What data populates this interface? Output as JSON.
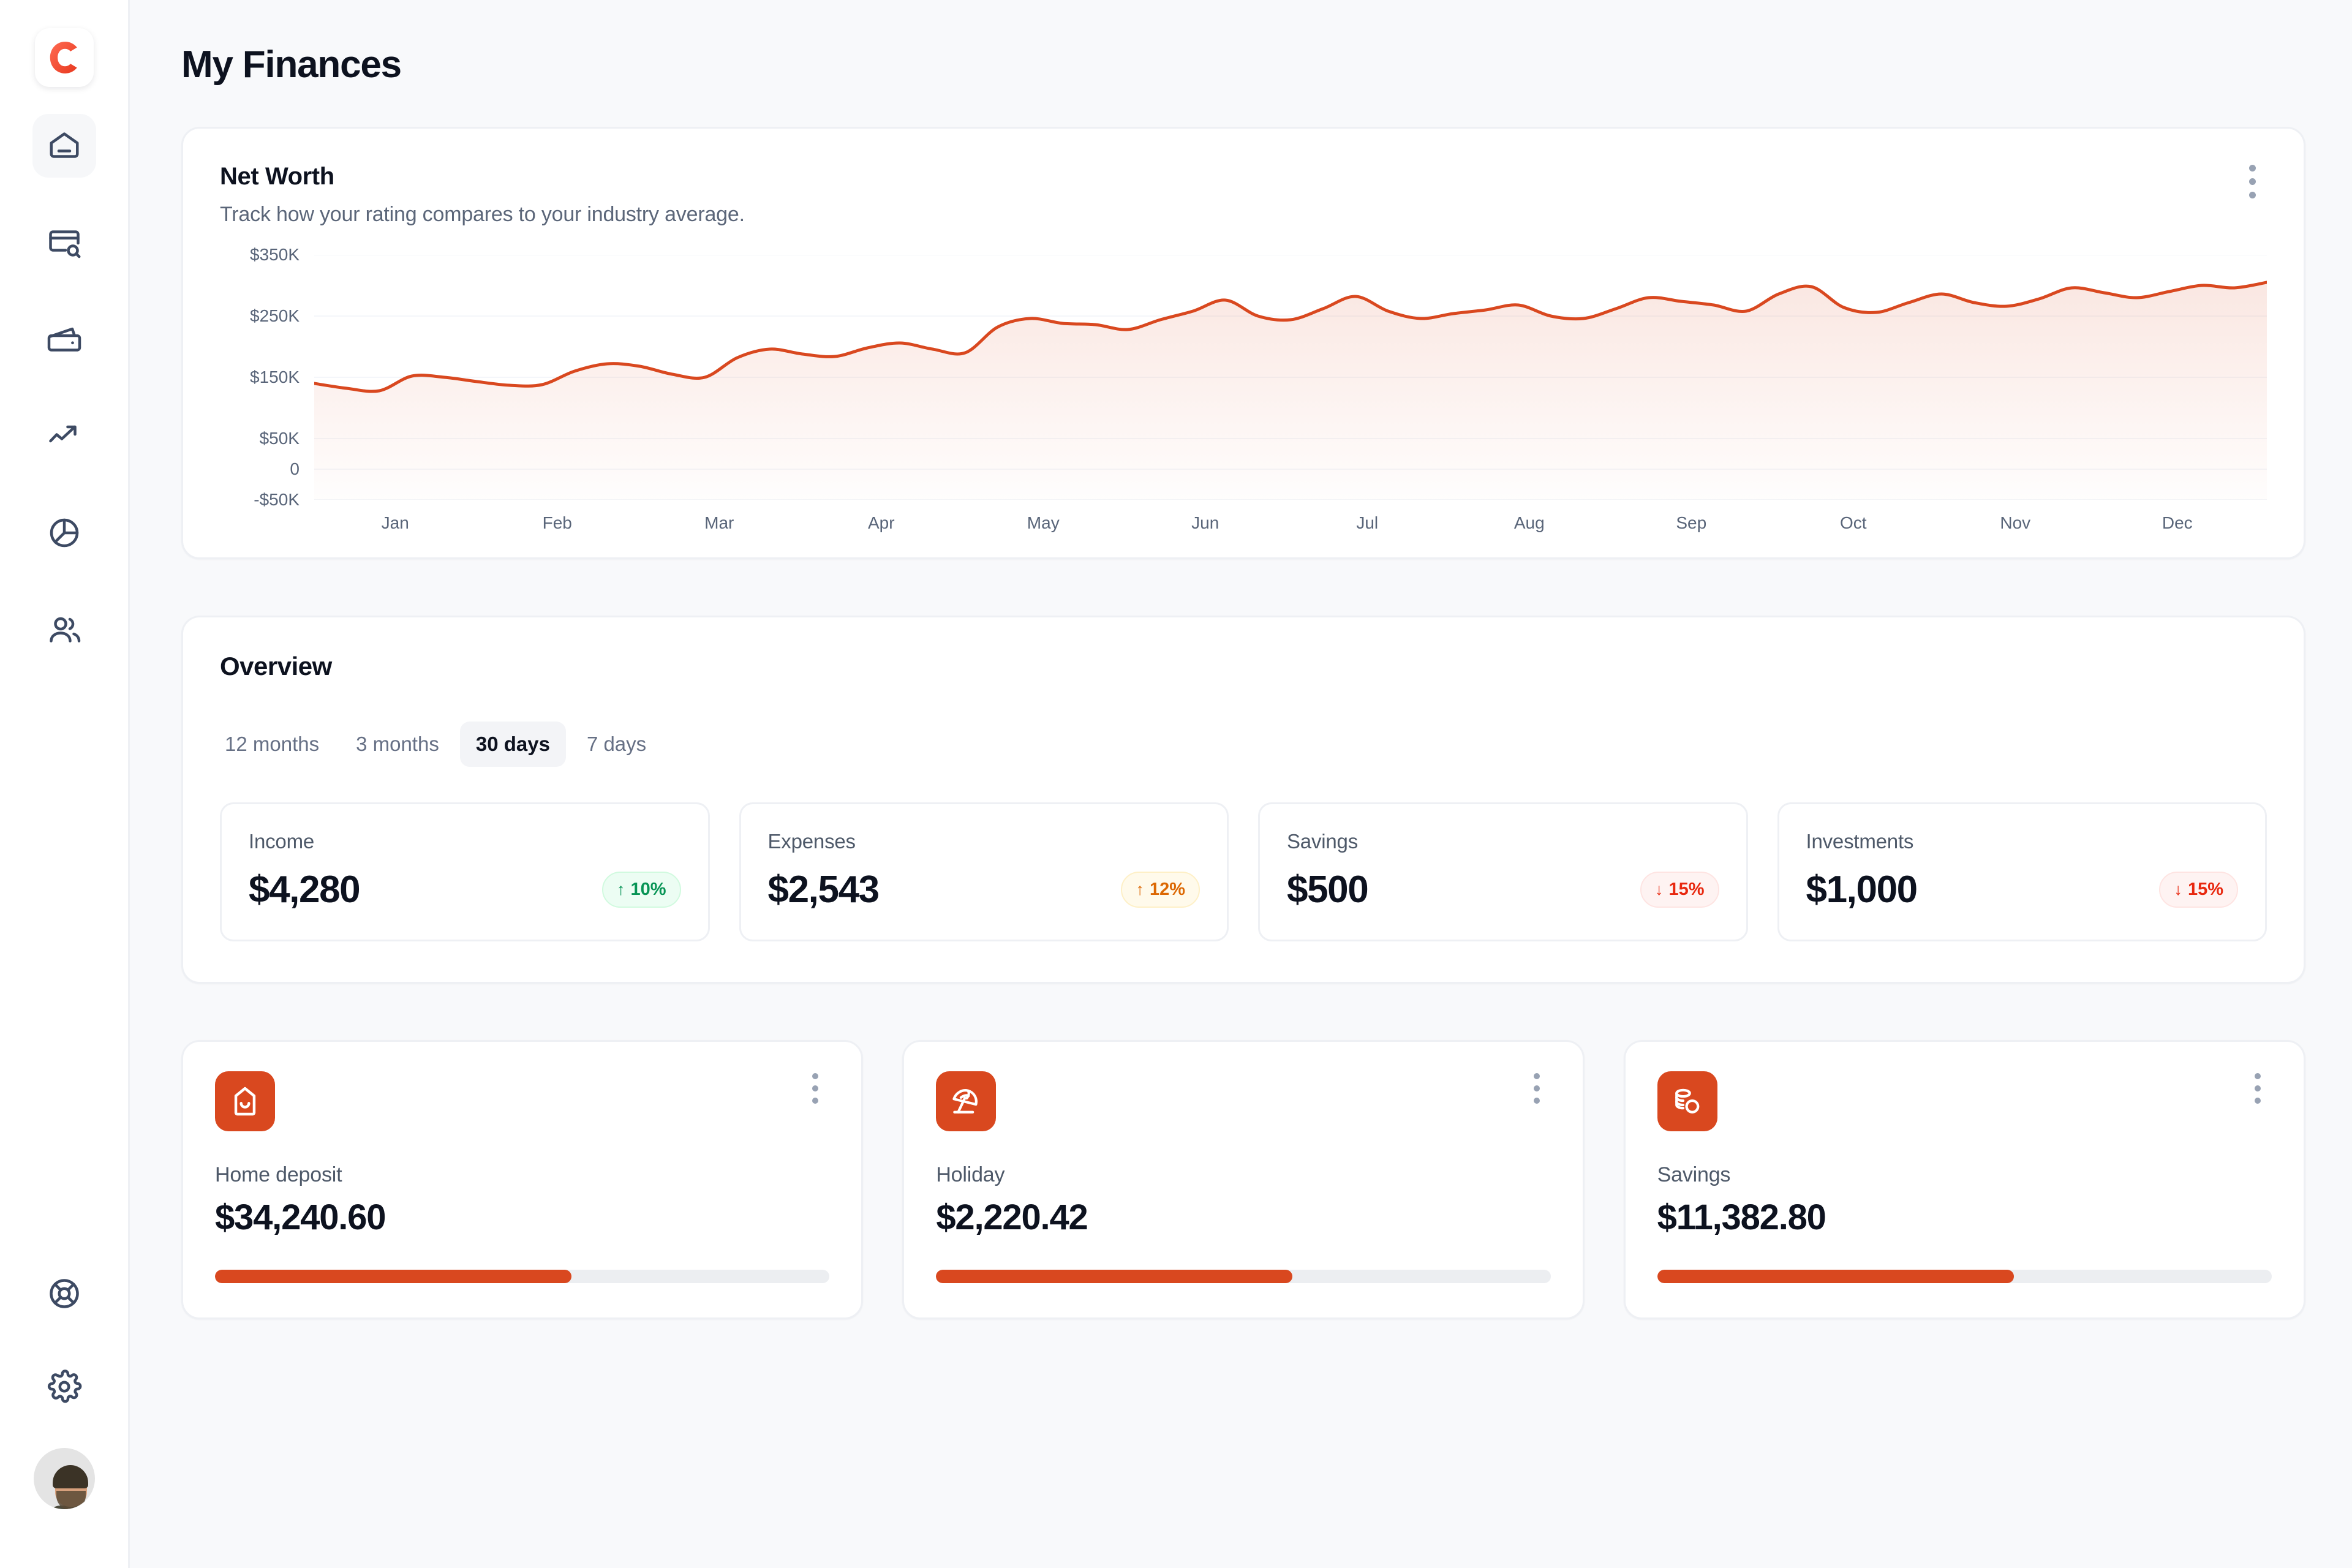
{
  "sidebar": {
    "logo": {
      "icon": "logo-c-icon",
      "letter": "c"
    },
    "items": [
      {
        "icon": "home-icon",
        "name": "home",
        "active": true
      },
      {
        "icon": "card-search-icon",
        "name": "transactions",
        "active": false
      },
      {
        "icon": "wallet-icon",
        "name": "wallet",
        "active": false
      },
      {
        "icon": "trend-up-icon",
        "name": "analytics",
        "active": false
      },
      {
        "icon": "pie-chart-icon",
        "name": "reports",
        "active": false
      },
      {
        "icon": "users-icon",
        "name": "people",
        "active": false
      }
    ],
    "bottom_items": [
      {
        "icon": "lifebuoy-icon",
        "name": "support"
      },
      {
        "icon": "gear-icon",
        "name": "settings"
      }
    ],
    "avatar": {
      "icon": "avatar",
      "name": "user-avatar"
    }
  },
  "header": {
    "title": "My Finances"
  },
  "net_worth": {
    "title": "Net Worth",
    "subtitle": "Track how your rating compares to your industry average.",
    "menu_icon": "kebab-menu-icon",
    "accent_color": "#d9481f"
  },
  "chart_data": {
    "type": "area",
    "title": "Net Worth",
    "subtitle": "Track how your rating compares to your industry average.",
    "xlabel": "",
    "ylabel": "",
    "grid": true,
    "legend": null,
    "ylim": [
      -50000,
      350000
    ],
    "ytick_labels": [
      "$350K",
      "$250K",
      "$150K",
      "$50K",
      "0",
      "-$50K"
    ],
    "ytick_values": [
      350000,
      250000,
      150000,
      50000,
      0,
      -50000
    ],
    "categories": [
      "Jan",
      "Feb",
      "Mar",
      "Apr",
      "May",
      "Jun",
      "Jul",
      "Aug",
      "Sep",
      "Oct",
      "Nov",
      "Dec"
    ],
    "series": [
      {
        "name": "Net Worth",
        "color": "#d9481f",
        "values": [
          140000,
          132000,
          128000,
          152000,
          150000,
          143000,
          137000,
          138000,
          160000,
          172000,
          168000,
          155000,
          150000,
          182000,
          196000,
          188000,
          184000,
          198000,
          206000,
          196000,
          190000,
          232000,
          246000,
          238000,
          236000,
          228000,
          244000,
          258000,
          276000,
          250000,
          244000,
          262000,
          282000,
          258000,
          246000,
          254000,
          260000,
          268000,
          250000,
          246000,
          262000,
          280000,
          274000,
          268000,
          258000,
          286000,
          298000,
          264000,
          256000,
          272000,
          286000,
          272000,
          266000,
          278000,
          296000,
          288000,
          280000,
          290000,
          300000,
          296000,
          305000
        ]
      }
    ]
  },
  "overview": {
    "title": "Overview",
    "tabs": [
      {
        "label": "12 months",
        "active": false
      },
      {
        "label": "3 months",
        "active": false
      },
      {
        "label": "30 days",
        "active": true
      },
      {
        "label": "7 days",
        "active": false
      }
    ],
    "stats": [
      {
        "label": "Income",
        "value": "$4,280",
        "badge": "10%",
        "direction": "up",
        "arrow": "↑",
        "tone": "up-green"
      },
      {
        "label": "Expenses",
        "value": "$2,543",
        "badge": "12%",
        "direction": "up",
        "arrow": "↑",
        "tone": "up-amber"
      },
      {
        "label": "Savings",
        "value": "$500",
        "badge": "15%",
        "direction": "down",
        "arrow": "↓",
        "tone": "down-red"
      },
      {
        "label": "Investments",
        "value": "$1,000",
        "badge": "15%",
        "direction": "down",
        "arrow": "↓",
        "tone": "down-red"
      }
    ]
  },
  "goals": [
    {
      "icon": "house-icon",
      "label": "Home deposit",
      "value": "$34,240.60",
      "progress": 58,
      "menu_icon": "kebab-menu-icon"
    },
    {
      "icon": "beach-umbrella-icon",
      "label": "Holiday",
      "value": "$2,220.42",
      "progress": 58,
      "menu_icon": "kebab-menu-icon"
    },
    {
      "icon": "coins-icon",
      "label": "Savings",
      "value": "$11,382.80",
      "progress": 58,
      "menu_icon": "kebab-menu-icon"
    }
  ],
  "colors": {
    "accent": "#d9481f",
    "page_bg": "#f8f9fb",
    "card_border": "#eef0f4",
    "text_primary": "#0d121f",
    "text_secondary": "#5b6679",
    "positive": "#079455",
    "warning": "#dc6803",
    "negative": "#e8280f"
  }
}
